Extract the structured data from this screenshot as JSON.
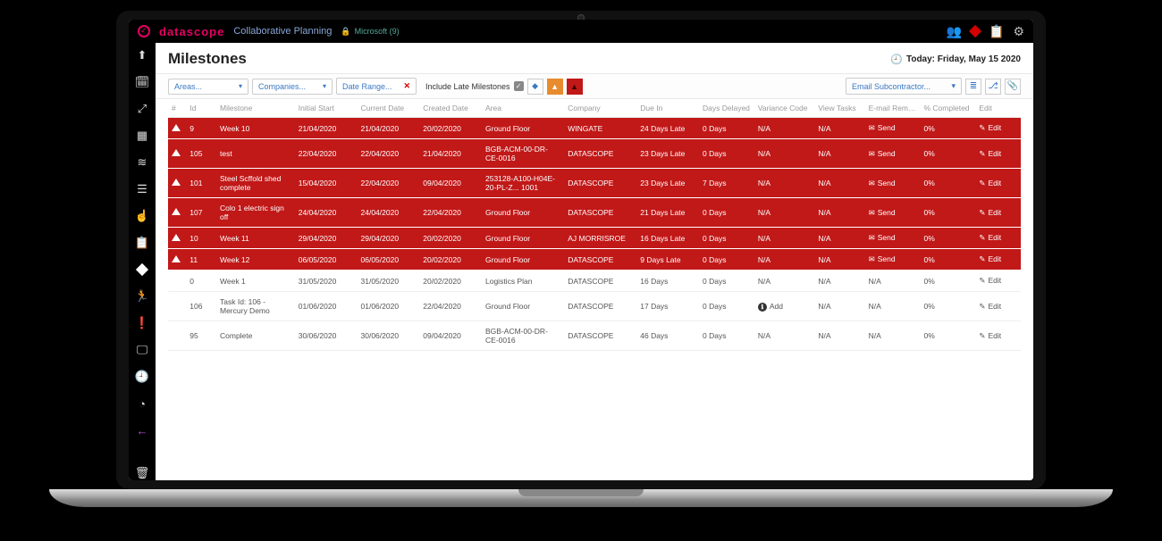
{
  "brand": {
    "name": "datascope",
    "section": "Collaborative Planning",
    "user_badge": "Microsoft (9)"
  },
  "page": {
    "title": "Milestones",
    "today_label": "Today: Friday, May 15 2020"
  },
  "filters": {
    "areas": "Areas...",
    "companies": "Companies...",
    "date_range": "Date Range...",
    "include_late": "Include Late Milestones",
    "email_sub": "Email Subcontractor..."
  },
  "columns": {
    "warn": "#",
    "id": "Id",
    "milestone": "Milestone",
    "initial": "Initial Start",
    "current": "Current Date",
    "created": "Created Date",
    "area": "Area",
    "company": "Company",
    "due": "Due In",
    "delayed": "Days Delayed",
    "variance": "Variance Code",
    "view": "View Tasks",
    "email": "E-mail Remin...",
    "pct": "% Completed",
    "edit": "Edit"
  },
  "labels": {
    "send": "Send",
    "edit": "Edit",
    "add": "Add",
    "na": "N/A"
  },
  "rows": [
    {
      "late": true,
      "id": "9",
      "ms": "Week 10",
      "init": "21/04/2020",
      "cur": "21/04/2020",
      "cre": "20/02/2020",
      "area": "Ground Floor",
      "comp": "WINGATE",
      "due": "24 Days Late",
      "delay": "0 Days",
      "var": "N/A",
      "view": "N/A",
      "email": "Send",
      "pct": "0%",
      "edit": "Edit"
    },
    {
      "late": true,
      "id": "105",
      "ms": "test",
      "init": "22/04/2020",
      "cur": "22/04/2020",
      "cre": "21/04/2020",
      "area": "BGB-ACM-00-DR-CE-0016",
      "comp": "DATASCOPE",
      "due": "23 Days Late",
      "delay": "0 Days",
      "var": "N/A",
      "view": "N/A",
      "email": "Send",
      "pct": "0%",
      "edit": "Edit"
    },
    {
      "late": true,
      "id": "101",
      "ms": "Steel Scffold shed complete",
      "init": "15/04/2020",
      "cur": "22/04/2020",
      "cre": "09/04/2020",
      "area": "253128-A100-H04E-20-PL-Z... 1001",
      "comp": "DATASCOPE",
      "due": "23 Days Late",
      "delay": "7 Days",
      "var": "N/A",
      "view": "N/A",
      "email": "Send",
      "pct": "0%",
      "edit": "Edit"
    },
    {
      "late": true,
      "id": "107",
      "ms": "Colo 1 electric sign off",
      "init": "24/04/2020",
      "cur": "24/04/2020",
      "cre": "22/04/2020",
      "area": "Ground Floor",
      "comp": "DATASCOPE",
      "due": "21 Days Late",
      "delay": "0 Days",
      "var": "N/A",
      "view": "N/A",
      "email": "Send",
      "pct": "0%",
      "edit": "Edit"
    },
    {
      "late": true,
      "id": "10",
      "ms": "Week 11",
      "init": "29/04/2020",
      "cur": "29/04/2020",
      "cre": "20/02/2020",
      "area": "Ground Floor",
      "comp": "AJ MORRISROE",
      "due": "16 Days Late",
      "delay": "0 Days",
      "var": "N/A",
      "view": "N/A",
      "email": "Send",
      "pct": "0%",
      "edit": "Edit"
    },
    {
      "late": true,
      "id": "11",
      "ms": "Week 12",
      "init": "06/05/2020",
      "cur": "06/05/2020",
      "cre": "20/02/2020",
      "area": "Ground Floor",
      "comp": "DATASCOPE",
      "due": "9 Days Late",
      "delay": "0 Days",
      "var": "N/A",
      "view": "N/A",
      "email": "Send",
      "pct": "0%",
      "edit": "Edit"
    },
    {
      "late": false,
      "id": "0",
      "ms": "Week 1",
      "init": "31/05/2020",
      "cur": "31/05/2020",
      "cre": "20/02/2020",
      "area": "Logistics Plan",
      "comp": "DATASCOPE",
      "due": "16 Days",
      "delay": "0 Days",
      "var": "N/A",
      "view": "N/A",
      "email": "N/A",
      "pct": "0%",
      "edit": "Edit"
    },
    {
      "late": false,
      "id": "106",
      "ms": "Task Id: 106 - Mercury Demo",
      "init": "01/06/2020",
      "cur": "01/06/2020",
      "cre": "22/04/2020",
      "area": "Ground Floor",
      "comp": "DATASCOPE",
      "due": "17 Days",
      "delay": "0 Days",
      "var": "Add",
      "varAdd": true,
      "view": "N/A",
      "email": "N/A",
      "pct": "0%",
      "edit": "Edit"
    },
    {
      "late": false,
      "id": "95",
      "ms": "Complete",
      "init": "30/06/2020",
      "cur": "30/06/2020",
      "cre": "09/04/2020",
      "area": "BGB-ACM-00-DR-CE-0016",
      "comp": "DATASCOPE",
      "due": "46 Days",
      "delay": "0 Days",
      "var": "N/A",
      "view": "N/A",
      "email": "N/A",
      "pct": "0%",
      "edit": "Edit"
    }
  ]
}
